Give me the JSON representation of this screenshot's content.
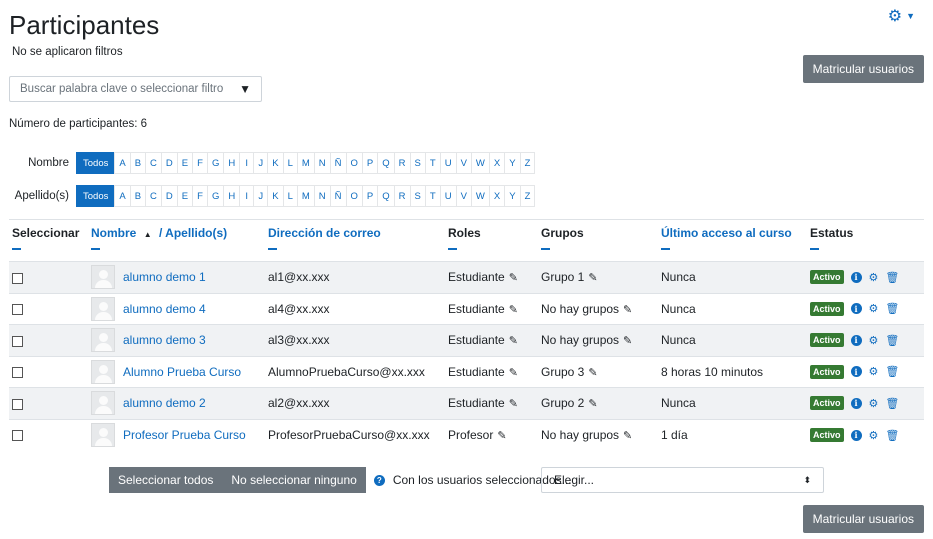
{
  "page": {
    "title": "Participantes",
    "no_filters": "No se aplicaron filtros",
    "count_label": "Número de participantes: 6"
  },
  "buttons": {
    "enrol": "Matricular usuarios",
    "select_all": "Seleccionar todos",
    "select_none": "No seleccionar ninguno"
  },
  "filter": {
    "placeholder": "Buscar palabra clave o seleccionar filtro"
  },
  "initials": {
    "first_label": "Nombre",
    "last_label": "Apellido(s)",
    "all": "Todos",
    "letters": [
      "A",
      "B",
      "C",
      "D",
      "E",
      "F",
      "G",
      "H",
      "I",
      "J",
      "K",
      "L",
      "M",
      "N",
      "Ñ",
      "O",
      "P",
      "Q",
      "R",
      "S",
      "T",
      "U",
      "V",
      "W",
      "X",
      "Y",
      "Z"
    ]
  },
  "table": {
    "headers": {
      "select": "Seleccionar",
      "name": "Nombre",
      "sort_icon": "▲",
      "lastname": "/ Apellido(s)",
      "email": "Dirección de correo",
      "roles": "Roles",
      "groups": "Grupos",
      "last_access": "Último acceso al curso",
      "status": "Estatus"
    },
    "rows": [
      {
        "name": "alumno demo 1",
        "email": "al1@xx.xxx",
        "role": "Estudiante",
        "group": "Grupo 1",
        "last_access": "Nunca",
        "status": "Activo"
      },
      {
        "name": "alumno demo 4",
        "email": "al4@xx.xxx",
        "role": "Estudiante",
        "group": "No hay grupos",
        "last_access": "Nunca",
        "status": "Activo"
      },
      {
        "name": "alumno demo 3",
        "email": "al3@xx.xxx",
        "role": "Estudiante",
        "group": "No hay grupos",
        "last_access": "Nunca",
        "status": "Activo"
      },
      {
        "name": "Alumno Prueba Curso",
        "email": "AlumnoPruebaCurso@xx.xxx",
        "role": "Estudiante",
        "group": "Grupo 3",
        "last_access": "8 horas 10 minutos",
        "status": "Activo"
      },
      {
        "name": "alumno demo 2",
        "email": "al2@xx.xxx",
        "role": "Estudiante",
        "group": "Grupo 2",
        "last_access": "Nunca",
        "status": "Activo"
      },
      {
        "name": "Profesor Prueba Curso",
        "email": "ProfesorPruebaCurso@xx.xxx",
        "role": "Profesor",
        "group": "No hay grupos",
        "last_access": "1 día",
        "status": "Activo"
      }
    ]
  },
  "bulk": {
    "with_selected": "Con los usuarios seleccionados...",
    "choose": "Elegir..."
  },
  "icons": {
    "settings": "gear-icon",
    "edit": "pencil-icon",
    "info": "info-icon",
    "manage": "cog-icon",
    "delete": "trash-icon",
    "help": "question-icon"
  },
  "colors": {
    "accent": "#0f6cbf",
    "active_badge": "#357a32",
    "button": "#6a737b"
  }
}
